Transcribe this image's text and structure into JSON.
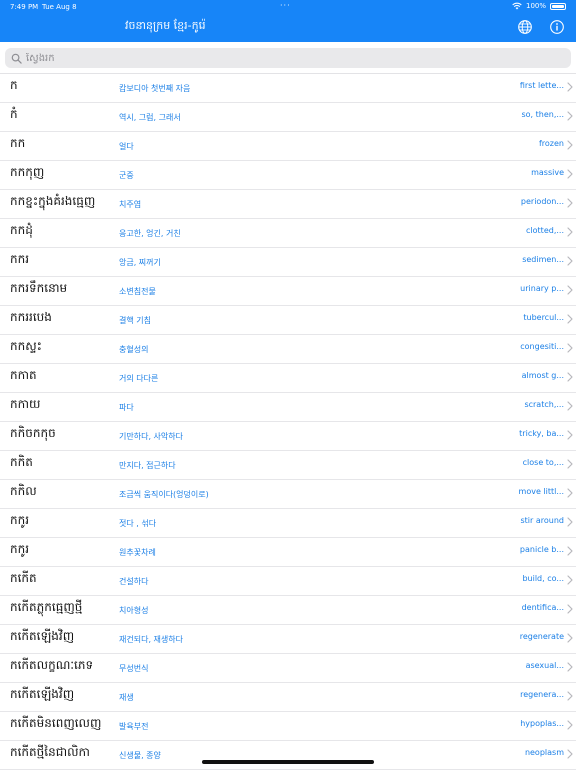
{
  "status": {
    "time": "7:49 PM",
    "date": "Tue Aug 8",
    "dots": "···",
    "battery": "100%"
  },
  "header": {
    "title": "វចនានុក្រម ខ្មែរ-កូរ៉េ"
  },
  "search": {
    "placeholder": "ស្វែងរក"
  },
  "colors": {
    "accent": "#1785f8",
    "link": "#1b7fe6"
  },
  "entries": [
    {
      "khmer": "ក",
      "korean": "캄보디아 첫번째 자음",
      "english": "first lette..."
    },
    {
      "khmer": "កំ",
      "korean": "역시, 그럼, 그래서",
      "english": "so, then,..."
    },
    {
      "khmer": "កក",
      "korean": "얼다",
      "english": "frozen"
    },
    {
      "khmer": "កកកុញ",
      "korean": "군중",
      "english": "massive"
    },
    {
      "khmer": "កកខ្នះក្នុងគំរងធ្មេញ",
      "korean": "치주염",
      "english": "periodon..."
    },
    {
      "khmer": "កកដុំ",
      "korean": "응고한, 엉긴, 거친",
      "english": "clotted,..."
    },
    {
      "khmer": "កករ",
      "korean": "앙금, 찌꺼기",
      "english": "sedimen..."
    },
    {
      "khmer": "កករទឹកនោម",
      "korean": "소변침전물",
      "english": "urinary p..."
    },
    {
      "khmer": "កកររបេង",
      "korean": "결핵 기침",
      "english": "tubercul..."
    },
    {
      "khmer": "កកស្ទះ",
      "korean": "충혈성의",
      "english": "congesiti..."
    },
    {
      "khmer": "កកាត",
      "korean": "거의 다다른",
      "english": "almost g..."
    },
    {
      "khmer": "កកាយ",
      "korean": "파다",
      "english": "scratch,..."
    },
    {
      "khmer": "កកិចកកុច",
      "korean": "기만하다, 사악하다",
      "english": "tricky, ba..."
    },
    {
      "khmer": "កកិត",
      "korean": "만지다, 접근하다",
      "english": "close to,..."
    },
    {
      "khmer": "កកិល",
      "korean": "조금씩 움직이다(엉덩이로)",
      "english": "move littl..."
    },
    {
      "khmer": "កកូរ",
      "korean": "젓다 , 섞다",
      "english": "stir around"
    },
    {
      "khmer": "កកូរ",
      "korean": "원추꽃차례",
      "english": "panicle b..."
    },
    {
      "khmer": "កកើត",
      "korean": "건설하다",
      "english": "build, co..."
    },
    {
      "khmer": "កកើតភ្លុកធ្មេញថ្មី",
      "korean": "치아형성",
      "english": "dentifica..."
    },
    {
      "khmer": "កកើតឡើងវិញ",
      "korean": "재건되다, 재생하다",
      "english": "regenerate"
    },
    {
      "khmer": "កកើតលក្ខណៈភេទ",
      "korean": "무성번식",
      "english": "asexual..."
    },
    {
      "khmer": "កកើតឡើងវិញ",
      "korean": "재생",
      "english": "regenera..."
    },
    {
      "khmer": "កកើតមិនពេញលេញ",
      "korean": "발육부전",
      "english": "hypoplas..."
    },
    {
      "khmer": "កកើតថ្មីនៃជាលិកា",
      "korean": "신생물, 종양",
      "english": "neoplasm"
    }
  ]
}
